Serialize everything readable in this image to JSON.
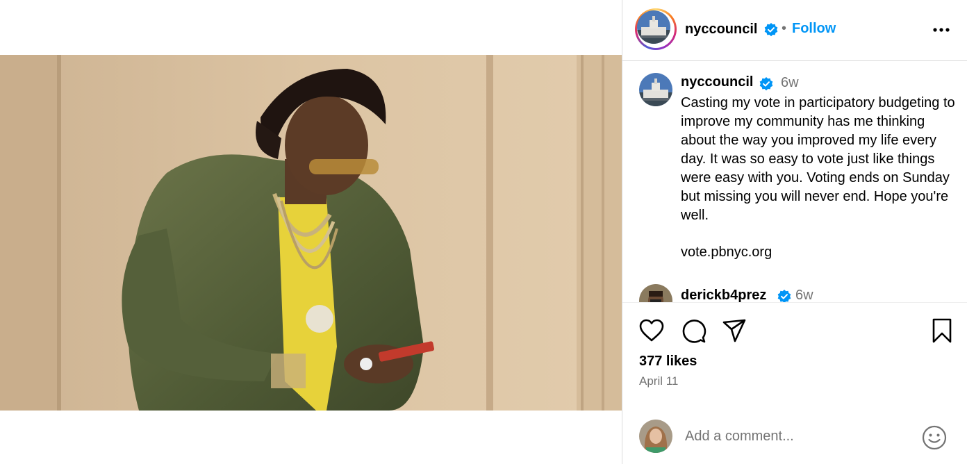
{
  "post": {
    "username": "nyccouncil",
    "follow_label": "Follow",
    "separator": "•"
  },
  "caption": {
    "username": "nyccouncil",
    "time": "6w",
    "text": "Casting my vote in participatory budgeting to improve my community has me thinking about the way you improved my life every day. It was so easy to vote just like things were easy with you. Voting ends on Sunday but missing you will never end. Hope you're well.",
    "link": "vote.pbnyc.org"
  },
  "comments": [
    {
      "username": "derickb4prez",
      "time": "6w"
    }
  ],
  "engagement": {
    "likes": "377 likes",
    "date": "April 11"
  },
  "composer": {
    "placeholder": "Add a comment..."
  },
  "colors": {
    "accent": "#0095f6",
    "verified": "#0095f6",
    "muted": "#737373",
    "border": "#dbdbdb"
  },
  "icons": {
    "more": "more-dots-icon",
    "like": "heart-icon",
    "comment": "speech-bubble-icon",
    "share": "paper-plane-icon",
    "save": "bookmark-icon",
    "emoji": "smiley-icon",
    "verified": "verified-badge-icon"
  }
}
